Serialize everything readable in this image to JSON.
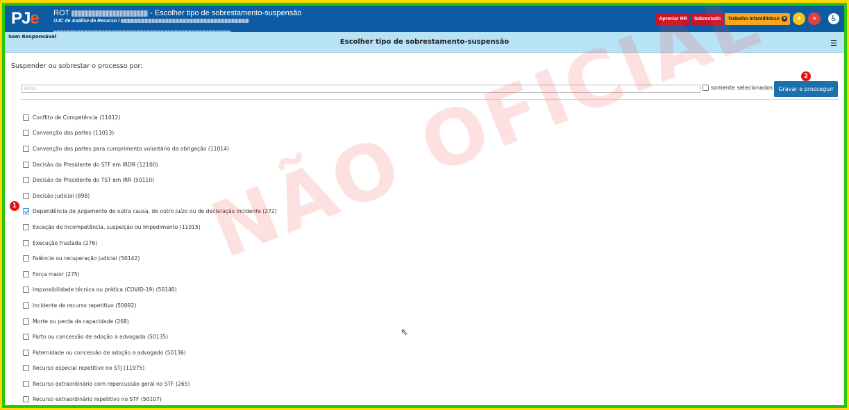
{
  "header": {
    "logo_pj": "PJ",
    "logo_e": "e",
    "process_prefix": "ROT",
    "page_title": "- Escolher tipo de sobrestamento-suspensão",
    "org_unit": "OJC de Análise de Recurso /",
    "tags": [
      {
        "label": "Apreciar RR",
        "color": "#c8152b"
      },
      {
        "label": "Sobrestado",
        "color": "#c8152b"
      },
      {
        "label": "Trabalho Infantil/Idoso",
        "color": "#f7a51b"
      }
    ],
    "plus_icon": "plus-icon",
    "forward_icon": "double-chevron-icon",
    "accessibility_icon": "accessibility-icon"
  },
  "subbar": {
    "responsible": "Sem Responsável",
    "title": "Escolher tipo de sobrestamento-suspensão",
    "menu_icon": "hamburger-icon"
  },
  "form": {
    "prompt": "Suspender ou sobrestar o processo por:",
    "filter_placeholder": "Filtro",
    "only_selected_label": "somente selecionados",
    "save_button": "Gravar e prosseguir"
  },
  "badges": {
    "first": "1",
    "second": "2"
  },
  "options": [
    {
      "label": "Conflito de Competência (11012)",
      "checked": false
    },
    {
      "label": "Convenção das partes (11013)",
      "checked": false
    },
    {
      "label": "Convenção das partes para cumprimento voluntário da obrigação (11014)",
      "checked": false
    },
    {
      "label": "Decisão do Presidente do STF em IRDR (12100)",
      "checked": false
    },
    {
      "label": "Decisão do Presidente do TST em IRR (50110)",
      "checked": false
    },
    {
      "label": "Decisão judicial (898)",
      "checked": false
    },
    {
      "label": "Dependência de julgamento de outra causa, de outro juízo ou de declaração incidente (272)",
      "checked": true
    },
    {
      "label": "Exceção de Incompetência, suspeição ou impedimento (11015)",
      "checked": false
    },
    {
      "label": "Execução frustada (276)",
      "checked": false
    },
    {
      "label": "Falência ou recuperação judicial (50142)",
      "checked": false
    },
    {
      "label": "Força maior (275)",
      "checked": false
    },
    {
      "label": "Impossibilidade técnica ou prática (COVID-19) (50140)",
      "checked": false
    },
    {
      "label": "Incidente de recurso repetitivo (50092)",
      "checked": false
    },
    {
      "label": "Morte ou perda da capacidade (268)",
      "checked": false
    },
    {
      "label": "Parto ou concessão de adoção a advogada (50135)",
      "checked": false
    },
    {
      "label": "Paternidade ou concessão de adoção a advogado (50136)",
      "checked": false
    },
    {
      "label": "Recurso especial repetitivo no STJ (11975)",
      "checked": false
    },
    {
      "label": "Recurso extraordinário com repercussão geral no STF (265)",
      "checked": false
    },
    {
      "label": "Recurso extraordinário repetitivo no STF (50107)",
      "checked": false
    }
  ],
  "watermark": "NÃO OFICIAL"
}
